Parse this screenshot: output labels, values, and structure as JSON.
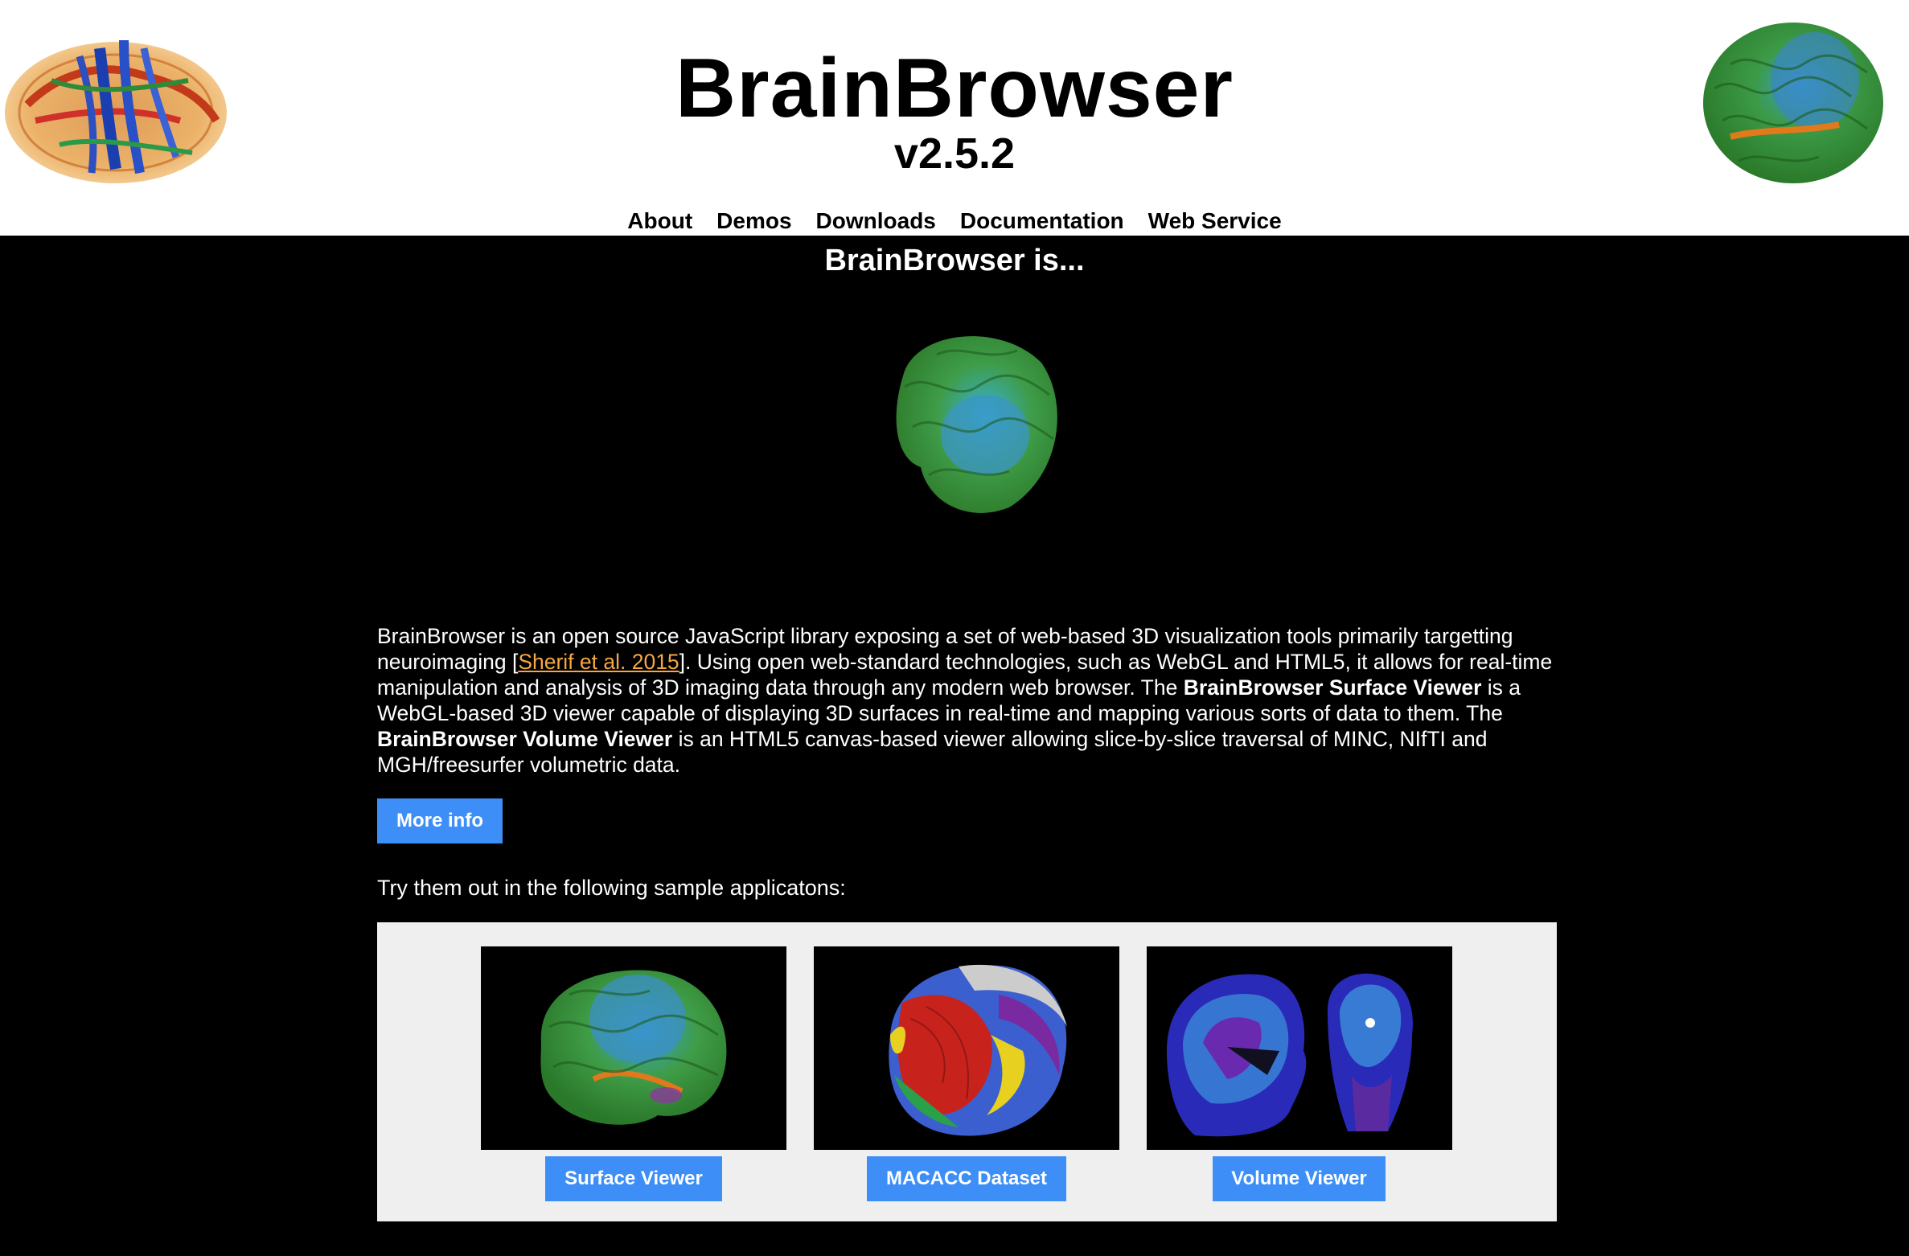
{
  "header": {
    "title": "BrainBrowser",
    "version": "v2.5.2",
    "logo_left": "tractography-brain-image",
    "logo_right": "surface-brain-image"
  },
  "nav": {
    "items": [
      "About",
      "Demos",
      "Downloads",
      "Documentation",
      "Web Service"
    ]
  },
  "main": {
    "section_title": "BrainBrowser is...",
    "hero_image": "rotating-brain-surface-image",
    "intro": {
      "p1": "BrainBrowser is an open source JavaScript library exposing a set of web-based 3D visualization tools primarily targetting neuroimaging [",
      "citation": "Sherif et al. 2015",
      "p2": "]. Using open web-standard technologies, such as WebGL and HTML5, it allows for real-time manipulation and analysis of 3D imaging data through any modern web browser. The ",
      "surface_viewer_bold": "BrainBrowser Surface Viewer",
      "p3": " is a WebGL-based 3D viewer capable of displaying 3D surfaces in real-time and mapping various sorts of data to them. The ",
      "volume_viewer_bold": "BrainBrowser Volume Viewer",
      "p4": " is an HTML5 canvas-based viewer allowing slice-by-slice traversal of MINC, NIfTI and MGH/freesurfer volumetric data."
    },
    "more_info_label": "More info",
    "try_text": "Try them out in the following sample applicatons:",
    "samples": [
      {
        "label": "Surface Viewer",
        "image": "surface-brain-thumbnail"
      },
      {
        "label": "MACACC Dataset",
        "image": "macacc-brain-thumbnail"
      },
      {
        "label": "Volume Viewer",
        "image": "mri-slices-thumbnail"
      }
    ]
  },
  "colors": {
    "background": "#000000",
    "header_bg": "#ffffff",
    "button": "#3d8ff7",
    "citation_link": "#f5a742",
    "samples_bg": "#efefef"
  }
}
